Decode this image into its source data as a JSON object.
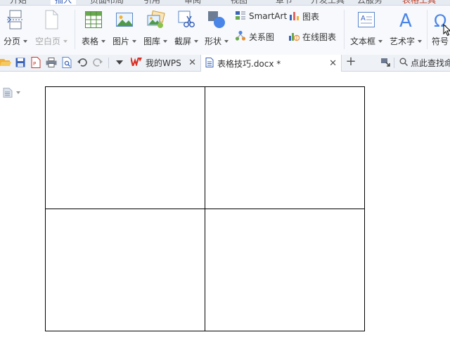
{
  "menu_tabs": [
    "开始",
    "插入",
    "页面布局",
    "引用",
    "审阅",
    "视图",
    "章节",
    "开发工具",
    "云服务",
    "表格工具"
  ],
  "ribbon": {
    "page_break": "分页",
    "blank_page": "空白页",
    "table": "表格",
    "picture": "图片",
    "gallery": "图库",
    "screenshot": "截屏",
    "shape": "形状",
    "smartart": "SmartArt",
    "chart": "图表",
    "relation_chart": "关系图",
    "online_chart": "在线图表",
    "textbox": "文本框",
    "wordart": "艺术字",
    "symbol": "符号"
  },
  "tabs": [
    {
      "label": "我的WPS"
    },
    {
      "label": "表格技巧.docx *"
    }
  ],
  "search": {
    "placeholder": "点此查找命令"
  },
  "document": {
    "table": {
      "rows": 2,
      "cols": 2,
      "cells": [
        [
          "",
          ""
        ],
        [
          "",
          ""
        ]
      ]
    }
  },
  "colors": {
    "accent": "#3a63b8",
    "wps_red": "#d93025",
    "ribbon_bg": "#f7f9fc"
  }
}
